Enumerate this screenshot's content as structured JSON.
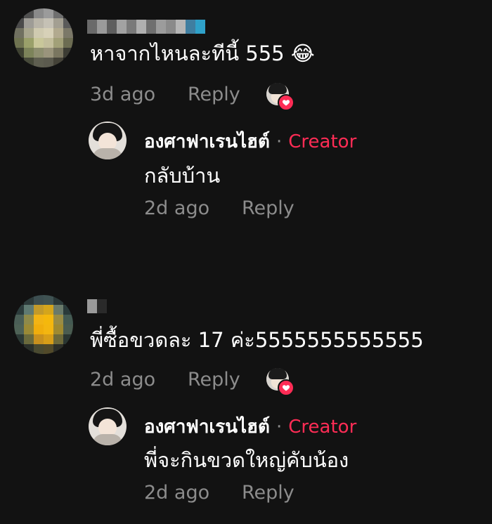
{
  "comments": [
    {
      "text": "หาจากไหนละทีนี้ 555",
      "emoji": "😂",
      "time": "3d ago",
      "reply_label": "Reply",
      "reply": {
        "author": "องศาฟาเรนไฮต์",
        "separator": "·",
        "badge": "Creator",
        "text": "กลับบ้าน",
        "time": "2d ago",
        "reply_label": "Reply"
      }
    },
    {
      "text": "พี่ซื้อขวดละ 17 ค่ะ5555555555555",
      "time": "2d ago",
      "reply_label": "Reply",
      "reply": {
        "author": "องศาฟาเรนไฮต์",
        "separator": "·",
        "badge": "Creator",
        "text": "พี่จะกินขวดใหญ่คับน้อง",
        "time": "2d ago",
        "reply_label": "Reply"
      }
    }
  ],
  "colors": {
    "background": "#121212",
    "meta_text": "#8c8c8c",
    "creator_badge": "#fe2c55",
    "like_heart": "#fe2c55"
  },
  "icons": {
    "liked_by_creator": "creator-avatar-with-heart-icon",
    "avatar": "pixelated-avatar"
  }
}
